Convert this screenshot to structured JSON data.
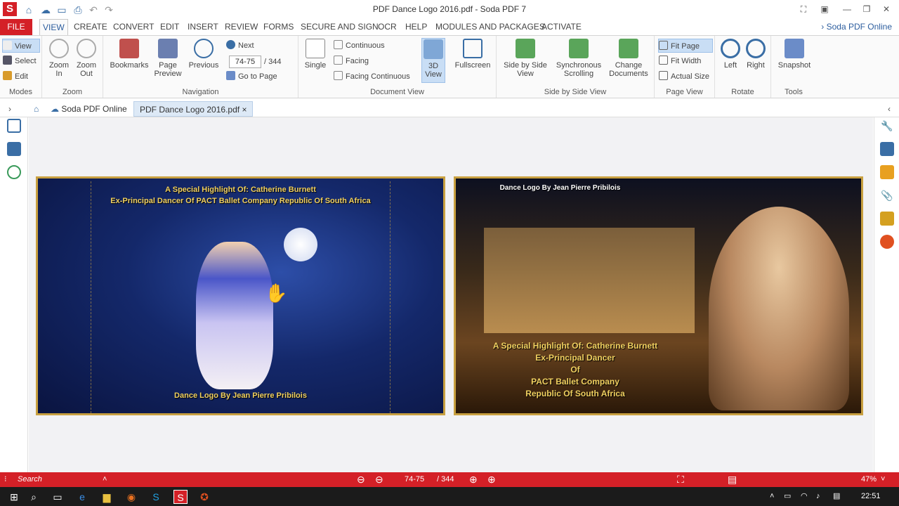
{
  "window": {
    "title": "PDF Dance Logo 2016.pdf   -   Soda PDF 7",
    "logo": "S"
  },
  "menu": [
    "FILE",
    "VIEW",
    "CREATE",
    "CONVERT",
    "EDIT",
    "INSERT",
    "REVIEW",
    "FORMS",
    "SECURE AND SIGN",
    "OCR",
    "HELP",
    "MODULES AND PACKAGES",
    "ACTIVATE"
  ],
  "online_link": "Soda PDF Online",
  "ribbon": {
    "modes": {
      "label": "Modes",
      "view": "View",
      "select": "Select",
      "edit": "Edit"
    },
    "zoom": {
      "label": "Zoom",
      "in": "Zoom\nIn",
      "out": "Zoom\nOut"
    },
    "navigation": {
      "label": "Navigation",
      "bookmarks": "Bookmarks",
      "page_preview": "Page\nPreview",
      "previous": "Previous",
      "next": "Next",
      "page_value": "74-75",
      "page_total": "/   344",
      "goto": "Go to Page"
    },
    "document_view": {
      "label": "Document View",
      "single": "Single",
      "continuous": "Continuous",
      "facing": "Facing",
      "facing_continuous": "Facing Continuous",
      "view3d": "3D\nView",
      "fullscreen": "Fullscreen"
    },
    "side_by_side": {
      "label": "Side by Side View",
      "sbs": "Side by Side\nView",
      "sync": "Synchronous\nScrolling",
      "change": "Change\nDocuments"
    },
    "page_view": {
      "label": "Page View",
      "fit_page": "Fit Page",
      "fit_width": "Fit Width",
      "actual_size": "Actual Size"
    },
    "rotate": {
      "label": "Rotate",
      "left": "Left",
      "right": "Right"
    },
    "tools": {
      "label": "Tools",
      "snapshot": "Snapshot"
    }
  },
  "tabs": {
    "online": "Soda PDF Online",
    "doc": "PDF Dance Logo 2016.pdf",
    "close": "×"
  },
  "page1": {
    "line1": "A Special Highlight Of: Catherine Burnett",
    "line2": "Ex-Principal Dancer Of PACT Ballet Company Republic Of South Africa",
    "footer": "Dance Logo By Jean Pierre Pribilois"
  },
  "page2": {
    "header": "Dance Logo By Jean Pierre Pribilois",
    "l1": "A Special Highlight Of: Catherine Burnett",
    "l2": "Ex-Principal Dancer",
    "l3": "Of",
    "l4": "PACT Ballet Company",
    "l5": "Republic Of South Africa"
  },
  "status": {
    "search": "Search",
    "page": "74-75",
    "total": "/ 344",
    "zoom": "47%"
  },
  "taskbar": {
    "time": "22:51"
  }
}
